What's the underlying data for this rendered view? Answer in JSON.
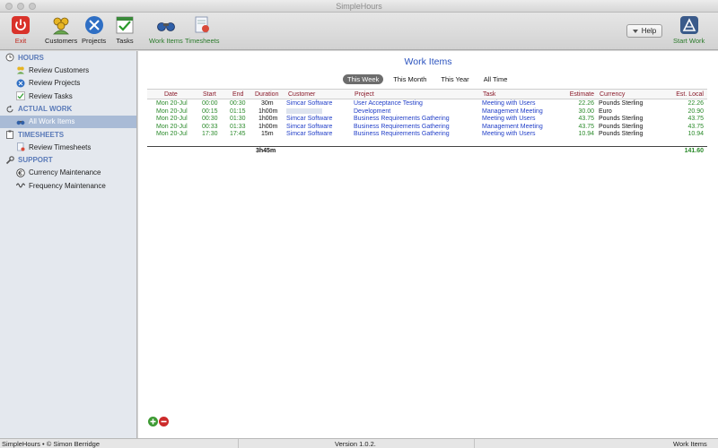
{
  "window": {
    "title": "SimpleHours"
  },
  "toolbar": {
    "exit": "Exit",
    "customers": "Customers",
    "projects": "Projects",
    "tasks": "Tasks",
    "work_items": "Work Items",
    "timesheets": "Timesheets",
    "help": "Help",
    "start_work": "Start Work"
  },
  "sidebar": {
    "hours": {
      "header": "HOURS",
      "items": [
        "Review Customers",
        "Review Projects",
        "Review Tasks"
      ]
    },
    "actual_work": {
      "header": "ACTUAL WORK",
      "items": [
        "All Work Items"
      ]
    },
    "timesheets": {
      "header": "TIMESHEETS",
      "items": [
        "Review Timesheets"
      ]
    },
    "support": {
      "header": "SUPPORT",
      "items": [
        "Currency Maintenance",
        "Frequency Maintenance"
      ]
    }
  },
  "main": {
    "title": "Work Items",
    "tabs": [
      "This Week",
      "This Month",
      "This Year",
      "All Time"
    ],
    "active_tab": "This Week",
    "columns": {
      "date": "Date",
      "start": "Start",
      "end": "End",
      "duration": "Duration",
      "customer": "Customer",
      "project": "Project",
      "task": "Task",
      "estimate": "Estimate",
      "currency": "Currency",
      "est_local": "Est. Local"
    },
    "rows": [
      {
        "date": "Mon 20-Jul",
        "start": "00:00",
        "end": "00:30",
        "duration": "30m",
        "customer": "Simcar Software",
        "project": "User Acceptance Testing",
        "task": "Meeting with Users",
        "estimate": "22.26",
        "currency": "Pounds Sterling",
        "est_local": "22.26"
      },
      {
        "date": "Mon 20-Jul",
        "start": "00:15",
        "end": "01:15",
        "duration": "1h00m",
        "customer": "",
        "project": "Development",
        "task": "Management Meeting",
        "estimate": "30.00",
        "currency": "Euro",
        "est_local": "20.90"
      },
      {
        "date": "Mon 20-Jul",
        "start": "00:30",
        "end": "01:30",
        "duration": "1h00m",
        "customer": "Simcar Software",
        "project": "Business Requirements Gathering",
        "task": "Meeting with Users",
        "estimate": "43.75",
        "currency": "Pounds Sterling",
        "est_local": "43.75"
      },
      {
        "date": "Mon 20-Jul",
        "start": "00:33",
        "end": "01:33",
        "duration": "1h00m",
        "customer": "Simcar Software",
        "project": "Business Requirements Gathering",
        "task": "Management Meeting",
        "estimate": "43.75",
        "currency": "Pounds Sterling",
        "est_local": "43.75"
      },
      {
        "date": "Mon 20-Jul",
        "start": "17:30",
        "end": "17:45",
        "duration": "15m",
        "customer": "Simcar Software",
        "project": "Business Requirements Gathering",
        "task": "Meeting with Users",
        "estimate": "10.94",
        "currency": "Pounds Sterling",
        "est_local": "10.94"
      }
    ],
    "totals": {
      "duration": "3h45m",
      "est_local": "141.60"
    }
  },
  "status": {
    "left": "SimpleHours • © Simon Berridge",
    "center": "Version 1.0.2.",
    "right": "Work Items"
  },
  "colors": {
    "accent_blue": "#2a52be",
    "green": "#2a8a2a",
    "header_red": "#8a1a2a",
    "sidebar_bg": "#e4e8ee",
    "sidebar_selected": "#a9bbd6"
  }
}
